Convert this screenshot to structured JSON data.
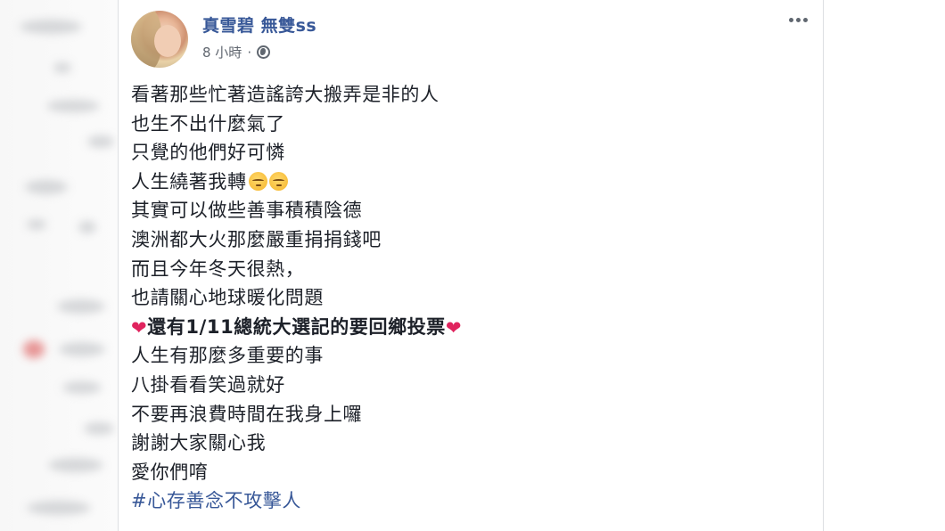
{
  "post": {
    "author_name": "真雪碧 無雙ss",
    "time": "8 小時",
    "separator": "·",
    "privacy_icon": "globe-icon",
    "more_icon": "more-dots-icon",
    "lines": [
      "看著那些忙著造謠誇大搬弄是非的人",
      "也生不出什麼氣了",
      "只覺的他們好可憐",
      "人生繞著我轉",
      "其實可以做些善事積積陰德",
      "澳洲都大火那麼嚴重捐捐錢吧",
      "而且今年冬天很熱，",
      "也請關心地球暖化問題",
      "還有1/11總統大選記的要回鄉投票",
      "人生有那麼多重要的事",
      "八掛看看笑過就好",
      "不要再浪費時間在我身上囉",
      "謝謝大家關心我",
      "愛你們唷"
    ],
    "hashtag": "#心存善念不攻擊人",
    "emoji_sleepy": "sleepy-face-icon",
    "emoji_heart": "❤"
  },
  "colors": {
    "name_blue": "#385898",
    "text": "#1d2129",
    "meta_gray": "#616770",
    "heart_red": "#e0245e"
  }
}
